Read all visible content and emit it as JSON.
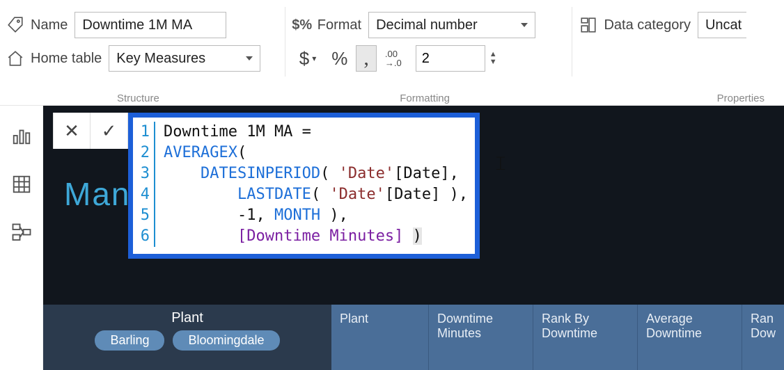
{
  "structure": {
    "name_label": "Name",
    "name_value": "Downtime 1M MA",
    "home_label": "Home table",
    "home_value": "Key Measures",
    "group_label": "Structure"
  },
  "formatting": {
    "format_label": "Format",
    "format_value": "Decimal number",
    "decimals_value": "2",
    "group_label": "Formatting",
    "dollar": "$",
    "percent": "%",
    "comma": ",",
    "dec_icon": ".00\n→.0"
  },
  "properties": {
    "cat_label": "Data category",
    "cat_value": "Uncat",
    "group_label": "Properties"
  },
  "formula": {
    "lines": [
      "Downtime 1M MA =",
      "AVERAGEX(",
      "    DATESINPERIOD( 'Date'[Date],",
      "        LASTDATE( 'Date'[Date] ),",
      "        -1, MONTH ),",
      "        [Downtime Minutes] )"
    ]
  },
  "report": {
    "logo": "Man",
    "slicer_title": "Plant",
    "slicer_buttons": [
      "Barling",
      "Bloomingdale"
    ],
    "table_headers": [
      "Plant",
      "Downtime Minutes",
      "Rank By Downtime",
      "Average Downtime",
      "Ran Dow"
    ]
  }
}
